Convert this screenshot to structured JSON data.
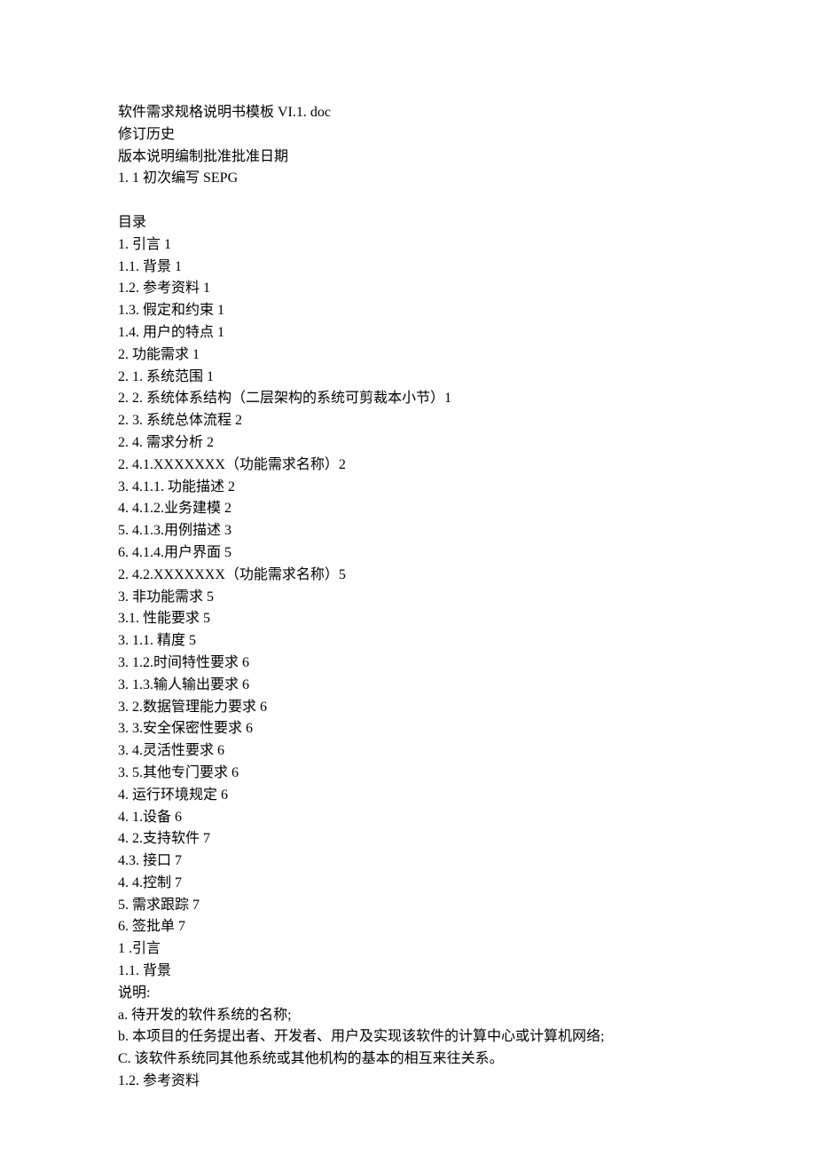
{
  "lines": [
    "软件需求规格说明书模板 VI.1. doc",
    "修订历史",
    "版本说明编制批准批准日期",
    "1. 1 初次编写 SEPG",
    "",
    "目录",
    "1. 引言 1",
    "1.1. 背景 1",
    "1.2. 参考资料 1",
    "1.3. 假定和约束 1",
    "1.4. 用户的特点 1",
    "2. 功能需求 1",
    "2. 1. 系统范围 1",
    "2. 2. 系统体系结构（二层架构的系统可剪裁本小节）1",
    "2. 3. 系统总体流程 2",
    "2. 4. 需求分析 2",
    "2. 4.1.XXXXXXX（功能需求名称）2",
    "3. 4.1.1. 功能描述 2",
    "4. 4.1.2.业务建模 2",
    "5. 4.1.3.用例描述 3",
    "6. 4.1.4.用户界面 5",
    "2. 4.2.XXXXXXX（功能需求名称）5",
    "3. 非功能需求 5",
    "3.1. 性能要求 5",
    "3. 1.1. 精度 5",
    "3. 1.2.时间特性要求 6",
    "3. 1.3.输人输出要求 6",
    "3. 2.数据管理能力要求 6",
    "3. 3.安全保密性要求 6",
    "3. 4.灵活性要求 6",
    "3. 5.其他专门要求 6",
    "4. 运行环境规定 6",
    "4. 1.设备 6",
    "4. 2.支持软件 7",
    "4.3. 接口 7",
    "4. 4.控制 7",
    "5. 需求跟踪 7",
    "6. 签批单 7",
    "1 .引言",
    "1.1. 背景",
    "说明:",
    "a. 待开发的软件系统的名称;",
    "b. 本项目的任务提出者、开发者、用户及实现该软件的计算中心或计算机网络;",
    "C. 该软件系统同其他系统或其他机构的基本的相互来往关系。",
    "1.2. 参考资料"
  ]
}
